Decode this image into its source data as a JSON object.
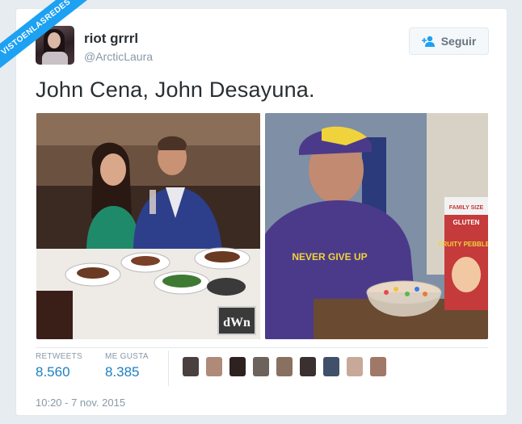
{
  "watermark": "VISTOENLASREDES",
  "user": {
    "name": "riot grrrl",
    "handle": "@ArcticLaura"
  },
  "follow_button": {
    "label": "Seguir",
    "icon": "person-plus-icon"
  },
  "tweet": {
    "text": "John Cena, John Desayuna."
  },
  "photos": [
    {
      "overlay_text": "dWn"
    },
    {
      "shirt_text": "NEVER GIVE UP",
      "box_text": "FAMILY SIZE",
      "box_brand": "FRUITY PEBBLES",
      "box_sub": "GLUTEN"
    }
  ],
  "stats": {
    "retweets_label": "RETWEETS",
    "retweets_value": "8.560",
    "likes_label": "ME GUSTA",
    "likes_value": "8.385"
  },
  "liker_avatar_colors": [
    "#4a4040",
    "#b08a78",
    "#2d2220",
    "#6e625c",
    "#8a7060",
    "#3b3030",
    "#40506a",
    "#c8a898",
    "#a07868"
  ],
  "timestamp": "10:20 - 7 nov. 2015",
  "colors": {
    "link": "#1d7fc1",
    "muted": "#8899a6",
    "text": "#292f33",
    "background": "#e6ecf0"
  }
}
